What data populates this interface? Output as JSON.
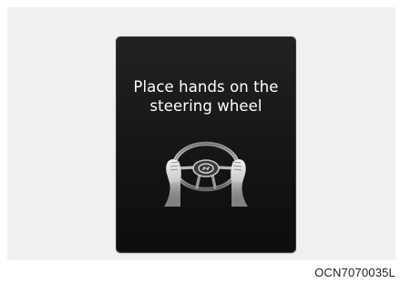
{
  "display": {
    "message_line1": "Place hands on the",
    "message_line2": "steering wheel",
    "icon": "hands-on-steering-wheel-icon"
  },
  "figure_code": "OCN7070035L",
  "colors": {
    "page_background": "#f0f0f0",
    "display_background": "#1a1a1a",
    "text": "#ffffff"
  }
}
